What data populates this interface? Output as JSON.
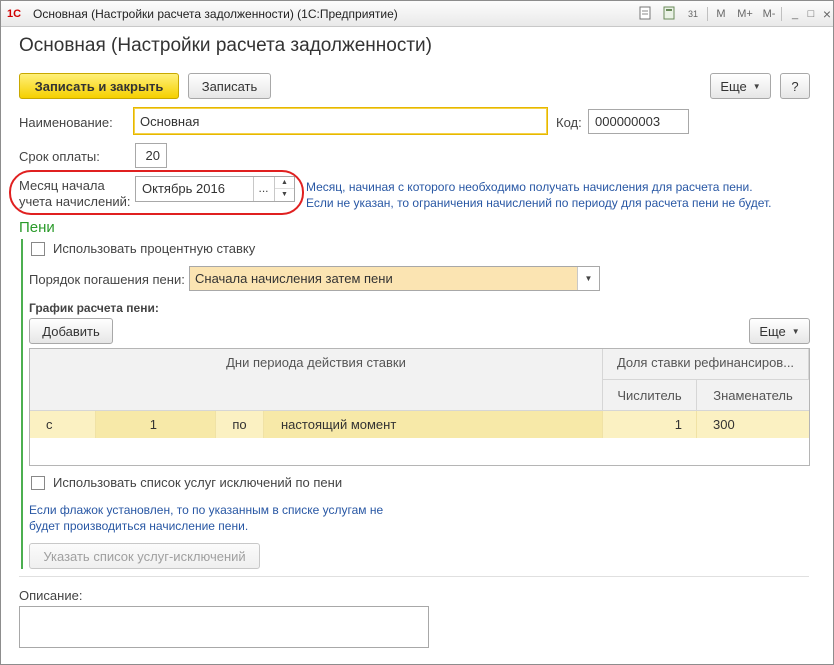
{
  "window": {
    "title": "Основная (Настройки расчета задолженности)  (1С:Предприятие)",
    "logo_text": "1С",
    "toolbar_icons": [
      "document-icon",
      "calculator-icon",
      "calendar-icon",
      "m-icon",
      "m-plus-icon",
      "m-minus-icon",
      "minimize-icon",
      "maximize-icon",
      "close-icon"
    ],
    "toolbar_labels": {
      "calendar": "31",
      "m": "M",
      "m_plus": "M+",
      "m_minus": "M-",
      "minimize": "_",
      "maximize": "□",
      "close": "×"
    }
  },
  "form": {
    "title": "Основная (Настройки расчета задолженности)",
    "commands": {
      "save_close": "Записать и закрыть",
      "save": "Записать",
      "more": "Еще",
      "help": "?"
    },
    "name_label": "Наименование:",
    "name_value": "Основная",
    "code_label": "Код:",
    "code_value": "000000003",
    "term_label": "Срок оплаты:",
    "term_value": "20",
    "month_label_line1": "Месяц начала",
    "month_label_line2": "учета начислений:",
    "month_value": "Октябрь 2016",
    "month_choose": "...",
    "month_hint_line1": "Месяц, начиная с которого необходимо получать начисления для расчета пени.",
    "month_hint_line2": "Если не указан, то ограничения начислений по периоду для расчета пени не будет."
  },
  "penalty": {
    "section_title": "Пени",
    "use_percent_label": "Использовать процентную ставку",
    "use_percent_checked": false,
    "order_label": "Порядок погашения пени:",
    "order_value": "Сначала начисления затем пени",
    "schedule_label": "График расчета пени:",
    "add_button": "Добавить",
    "more_button": "Еще",
    "grid": {
      "header_days": "Дни периода действия ставки",
      "header_share": "Доля ставки рефинансиров...",
      "header_numerator": "Числитель",
      "header_denominator": "Знаменатель",
      "rows": [
        {
          "c1": "с",
          "c2": "1",
          "c3": "по",
          "c4": "настоящий момент",
          "numerator": "1",
          "denominator": "300"
        }
      ]
    },
    "use_exclusions_label": "Использовать список услуг исключений по пени",
    "use_exclusions_checked": false,
    "exclusions_hint_line1": "Если флажок установлен, то по указанным в списке услугам не",
    "exclusions_hint_line2": "будет производиться начисление пени.",
    "exclusions_button": "Указать список услуг-исключений"
  },
  "description": {
    "label": "Описание:",
    "value": ""
  },
  "colors": {
    "primary_button": "#f5d000",
    "section_green": "#2a9a2a",
    "hint_blue": "#2857a4",
    "highlight_row": "#fbf1c2",
    "annotation_red": "#e02020"
  }
}
